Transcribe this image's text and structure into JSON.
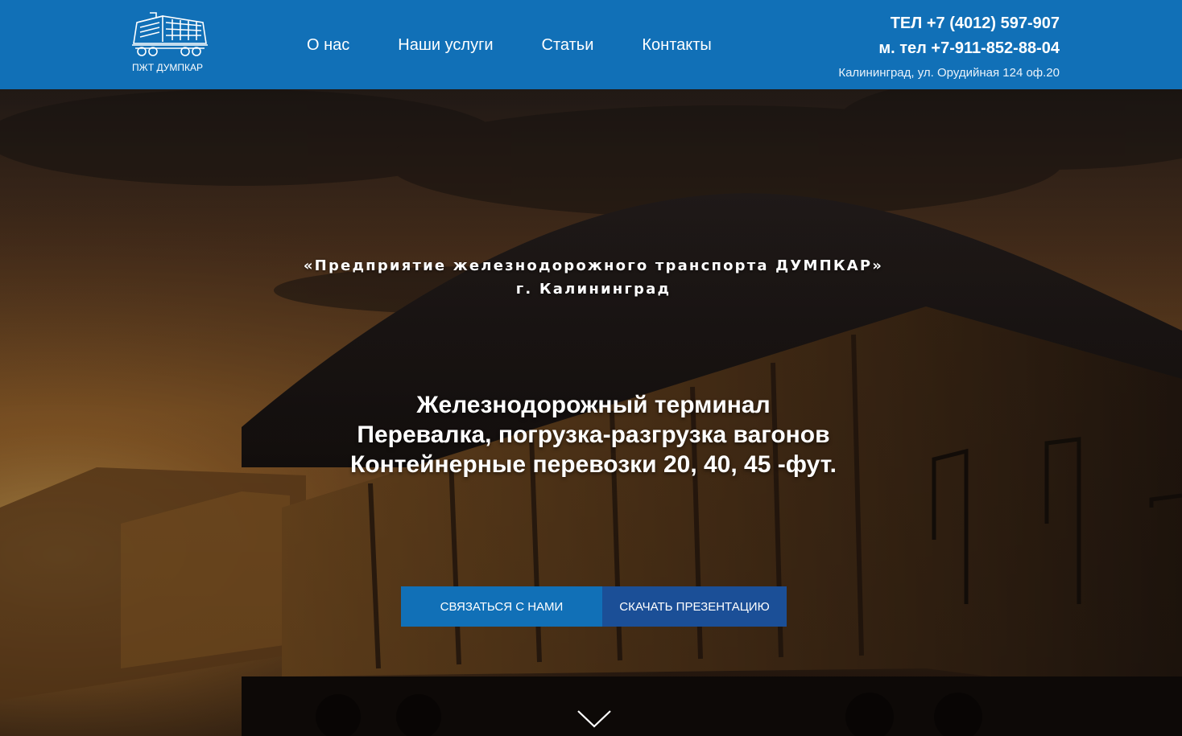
{
  "header": {
    "logo_text": "ПЖТ ДУМПКАР",
    "nav": [
      {
        "label": "О нас"
      },
      {
        "label": "Наши услуги"
      },
      {
        "label": "Статьи"
      },
      {
        "label": "Контакты"
      }
    ],
    "phone": "ТЕЛ +7 (4012) 597-907",
    "mobile": "м. тел +7-911-852-88-04",
    "address": "Калининград, ул. Орудийная 124 оф.20"
  },
  "hero": {
    "subtitle_line1": "«Предприятие железнодорожного транспорта ДУМПКАР»",
    "subtitle_line2": "г. Калининград",
    "title_line1": "Железнодорожный терминал",
    "title_line2": "Перевалка, погрузка-разгрузка вагонов",
    "title_line3": "Контейнерные перевозки 20, 40, 45 -фут.",
    "btn_contact": "СВЯЗАТЬСЯ С НАМИ",
    "btn_download": "СКАЧАТЬ ПРЕЗЕНТАЦИЮ"
  },
  "colors": {
    "header_bg": "#1170b7",
    "btn_contact_bg": "#1170b7",
    "btn_download_bg": "#1b4f97"
  },
  "icons": {
    "logo": "locomotive-icon",
    "scroll": "chevron-down-icon"
  }
}
